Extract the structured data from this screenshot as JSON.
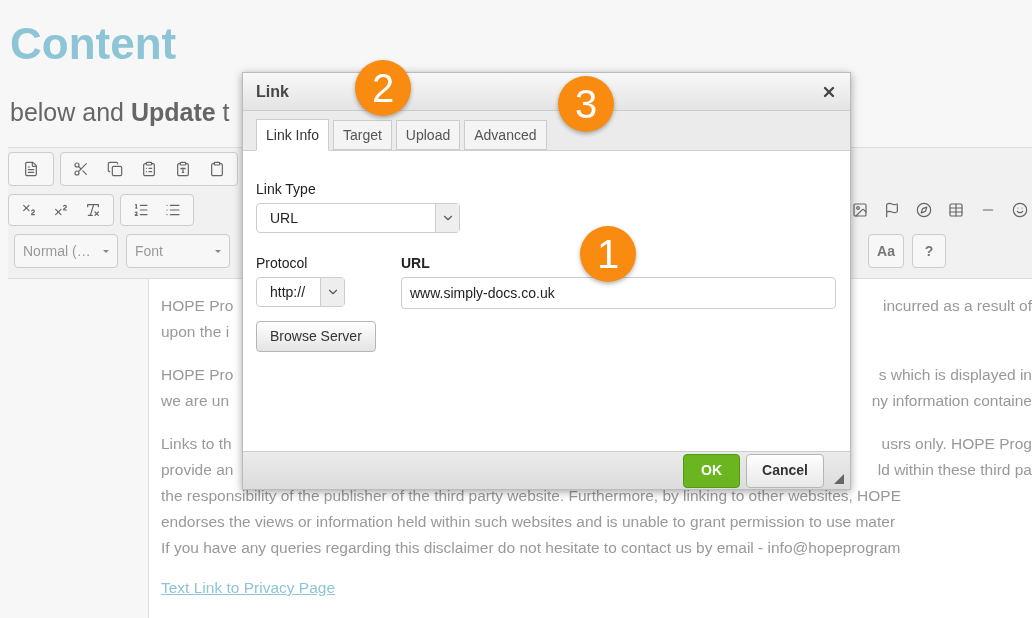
{
  "page": {
    "title": "Content",
    "subtitle": "below and **Update** t"
  },
  "toolbar": {
    "dropdowns": [
      {
        "label": "Normal (…"
      },
      {
        "label": "Font"
      }
    ],
    "buttons": [
      "Aa",
      "?"
    ]
  },
  "editor": {
    "lines": [
      {
        "left": "HOPE Pro",
        "right": "incurred as a result of"
      },
      {
        "left": "upon the i"
      },
      {
        "kind": "gap"
      },
      {
        "left": "HOPE Pro",
        "right": "s which is displayed in"
      },
      {
        "left": "we are un",
        "right": "ny information containe"
      },
      {
        "kind": "gap"
      },
      {
        "left": "Links to th",
        "right": "usrs only. HOPE Prog"
      },
      {
        "left": "provide an",
        "right": "ld within these third pa"
      },
      {
        "left": "the responsibility of the publisher of the third party website. Furthermore, by linking to other websites, HOPE"
      },
      {
        "left": "endorses the views or information held within such websites and is unable to grant permission to use mater"
      },
      {
        "left": "If you have any queries regarding this disclaimer do not hesitate to contact us by email - info@hopeprogram"
      },
      {
        "kind": "gap"
      },
      {
        "kind": "link",
        "left": "Text Link to Privacy Page"
      }
    ]
  },
  "dialog": {
    "title": "Link",
    "tabs": [
      {
        "label": "Link Info",
        "selected": true
      },
      {
        "label": "Target",
        "selected": false
      },
      {
        "label": "Upload",
        "selected": false
      },
      {
        "label": "Advanced",
        "selected": false
      }
    ],
    "link_type": {
      "label": "Link Type",
      "value": "URL"
    },
    "protocol": {
      "label": "Protocol",
      "value": "http://"
    },
    "url": {
      "label": "URL",
      "value": "www.simply-docs.co.uk"
    },
    "browse_button": "Browse Server",
    "buttons": [
      {
        "label": "OK",
        "kind": "primary"
      },
      {
        "label": "Cancel",
        "kind": "secondary"
      }
    ]
  },
  "callouts": [
    "1",
    "2",
    "3"
  ]
}
